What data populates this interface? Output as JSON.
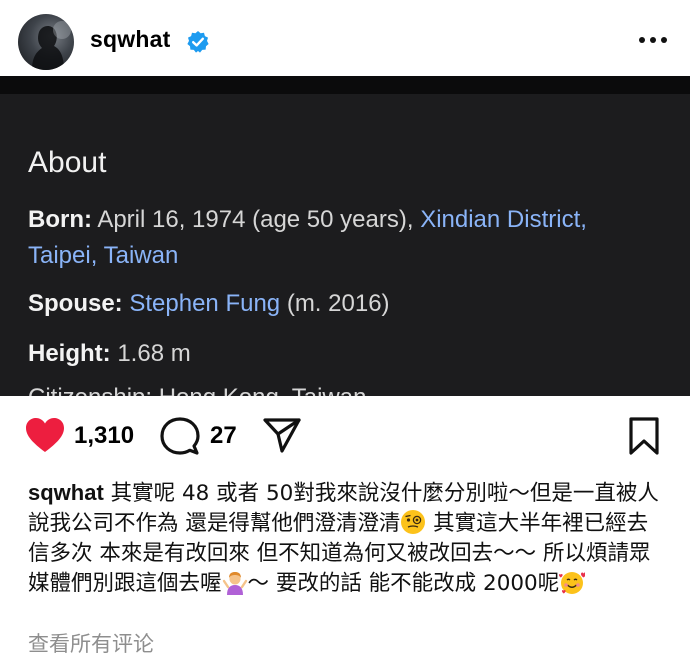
{
  "header": {
    "username": "sqwhat",
    "verified": true,
    "more_icon": "ellipsis-horizontal-icon"
  },
  "post_image": {
    "title": "About",
    "born": {
      "label": "Born:",
      "value": " April 16, 1974 (age 50 years), ",
      "place_link_1": "Xindian District,",
      "place_link_2": "Taipei, Taiwan"
    },
    "spouse": {
      "label": "Spouse:",
      "link": "Stephen Fung",
      "value": " (m. 2016)"
    },
    "height": {
      "label": "Height:",
      "value": " 1.68 m"
    },
    "cut_off_line": "Citizenship: Hong Kong, Taiwan"
  },
  "actions": {
    "likes": "1,310",
    "comments": "27",
    "heart_color": "#ed1e3f"
  },
  "caption": {
    "username": "sqwhat",
    "text_1": " 其實呢 48 或者 50對我來說沒什麼分別啦～但是一直被人說我公司不作為 還是得幫他們澄清澄清",
    "emoji_1": "face-with-monocle",
    "text_2": " 其實這大半年裡已經去信多次 本來是有改回來 但不知道為何又被改回去～～ 所以煩請眾媒體們別跟這個去喔",
    "emoji_2": "person-shrugging",
    "text_3": "～ 要改的話 能不能改成 2000呢",
    "emoji_3": "smiling-face-with-hearts"
  },
  "view_comments_label": "查看所有评论"
}
